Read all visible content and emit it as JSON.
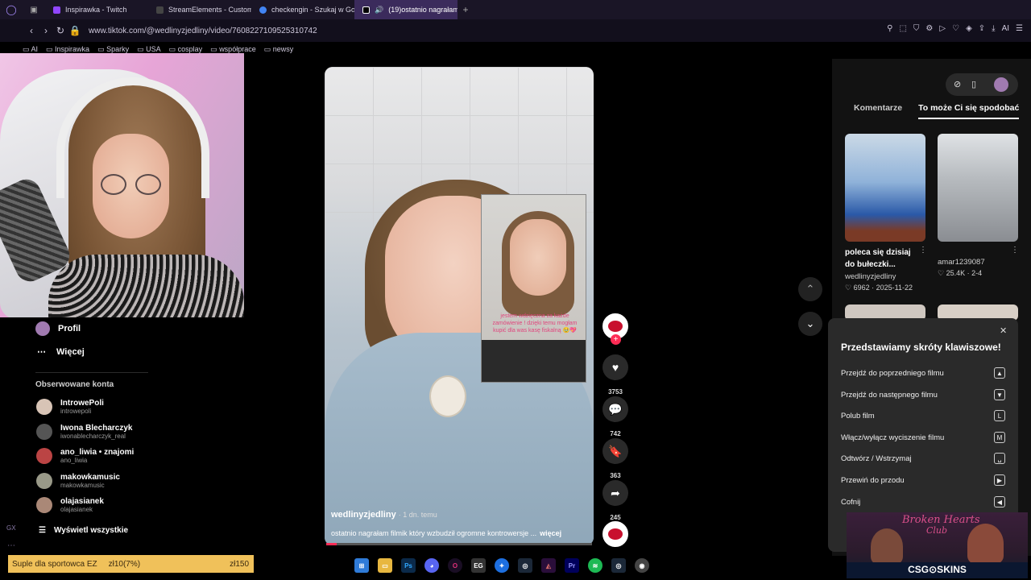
{
  "browser": {
    "tabs": [
      {
        "label": "Inspirawka - Twitch",
        "color": "#9146ff"
      },
      {
        "label": "StreamElements - Custom",
        "color": "#333"
      },
      {
        "label": "checkengin - Szukaj w Go",
        "color": "#4285f4"
      },
      {
        "label": "(19)ostatnio nagrałam",
        "color": "#111",
        "active": true
      }
    ],
    "url": "www.tiktok.com/@wedlinyzjedliny/video/7608227109525310742",
    "bookmarks": [
      "AI",
      "Inspirawka",
      "Sparky",
      "USA",
      "cosplay",
      "współprace",
      "newsy"
    ],
    "ext_ai_label": "AI"
  },
  "sidebar": {
    "profile_label": "Profil",
    "more_label": "Więcej",
    "followed_title": "Obserwowane konta",
    "followed": [
      {
        "name": "IntrowePoli",
        "handle": "introwepoli",
        "color": "#d8c4b6"
      },
      {
        "name": "Iwona Blecharczyk",
        "handle": "iwonablecharczyk_real",
        "color": "#555"
      },
      {
        "name": "ano_liwia • znajomi",
        "handle": "ano_liwia",
        "color": "#b44"
      },
      {
        "name": "makowkamusic",
        "handle": "makowkamusic",
        "color": "#998"
      },
      {
        "name": "olajasianek",
        "handle": "olajasianek",
        "color": "#a87"
      }
    ],
    "see_all_label": "Wyświetl wszystkie"
  },
  "video": {
    "author": "wedlinyzjedliny",
    "age": "· 1 dn. temu",
    "caption": "ostatnio nagrałam filmik który wzbudził ogromne kontrowersje ...",
    "more_label": "więcej",
    "inset_text": "jestem wdzięczna za każde zamówienie ! dzięki temu mogłam kupić dla was kasę fiskalną 🥹💖",
    "progress": 0.04,
    "likes": "3753",
    "comments": "742",
    "saves": "363",
    "shares": "245"
  },
  "right_panel": {
    "tab_comments": "Komentarze",
    "tab_suggested": "To może Ci się spodobać",
    "cards": [
      {
        "caption": "poleca się dzisiaj do bułeczki...",
        "user": "wedlinyzjedliny",
        "likes": "6962",
        "date": "2025-11-22"
      },
      {
        "caption": "",
        "user": "amar1239087",
        "likes": "25.4K",
        "date": "2-4"
      }
    ]
  },
  "shortcuts": {
    "title": "Przedstawiamy skróty klawiszowe!",
    "items": [
      {
        "label": "Przejdź do poprzedniego filmu",
        "key": "▲"
      },
      {
        "label": "Przejdź do następnego filmu",
        "key": "▼"
      },
      {
        "label": "Polub film",
        "key": "L"
      },
      {
        "label": "Włącz/wyłącz wyciszenie filmu",
        "key": "M"
      },
      {
        "label": "Odtwórz / Wstrzymaj",
        "key": "␣"
      },
      {
        "label": "Przewiń do przodu",
        "key": "▶"
      },
      {
        "label": "Cofnij",
        "key": "◀"
      }
    ]
  },
  "overlay": {
    "donation_label": "Suple dla sportowca EZ",
    "donation_progress": "zł10(7%)",
    "donation_goal": "zł150",
    "ad_title_1": "Broken Hearts",
    "ad_title_2": "Club",
    "ad_brand": "CSG⊙SKINS"
  },
  "colors": {
    "accent": "#fe2c55",
    "browser_active_tab": "#3b2b5c",
    "donation_bar": "#f0c15a"
  }
}
